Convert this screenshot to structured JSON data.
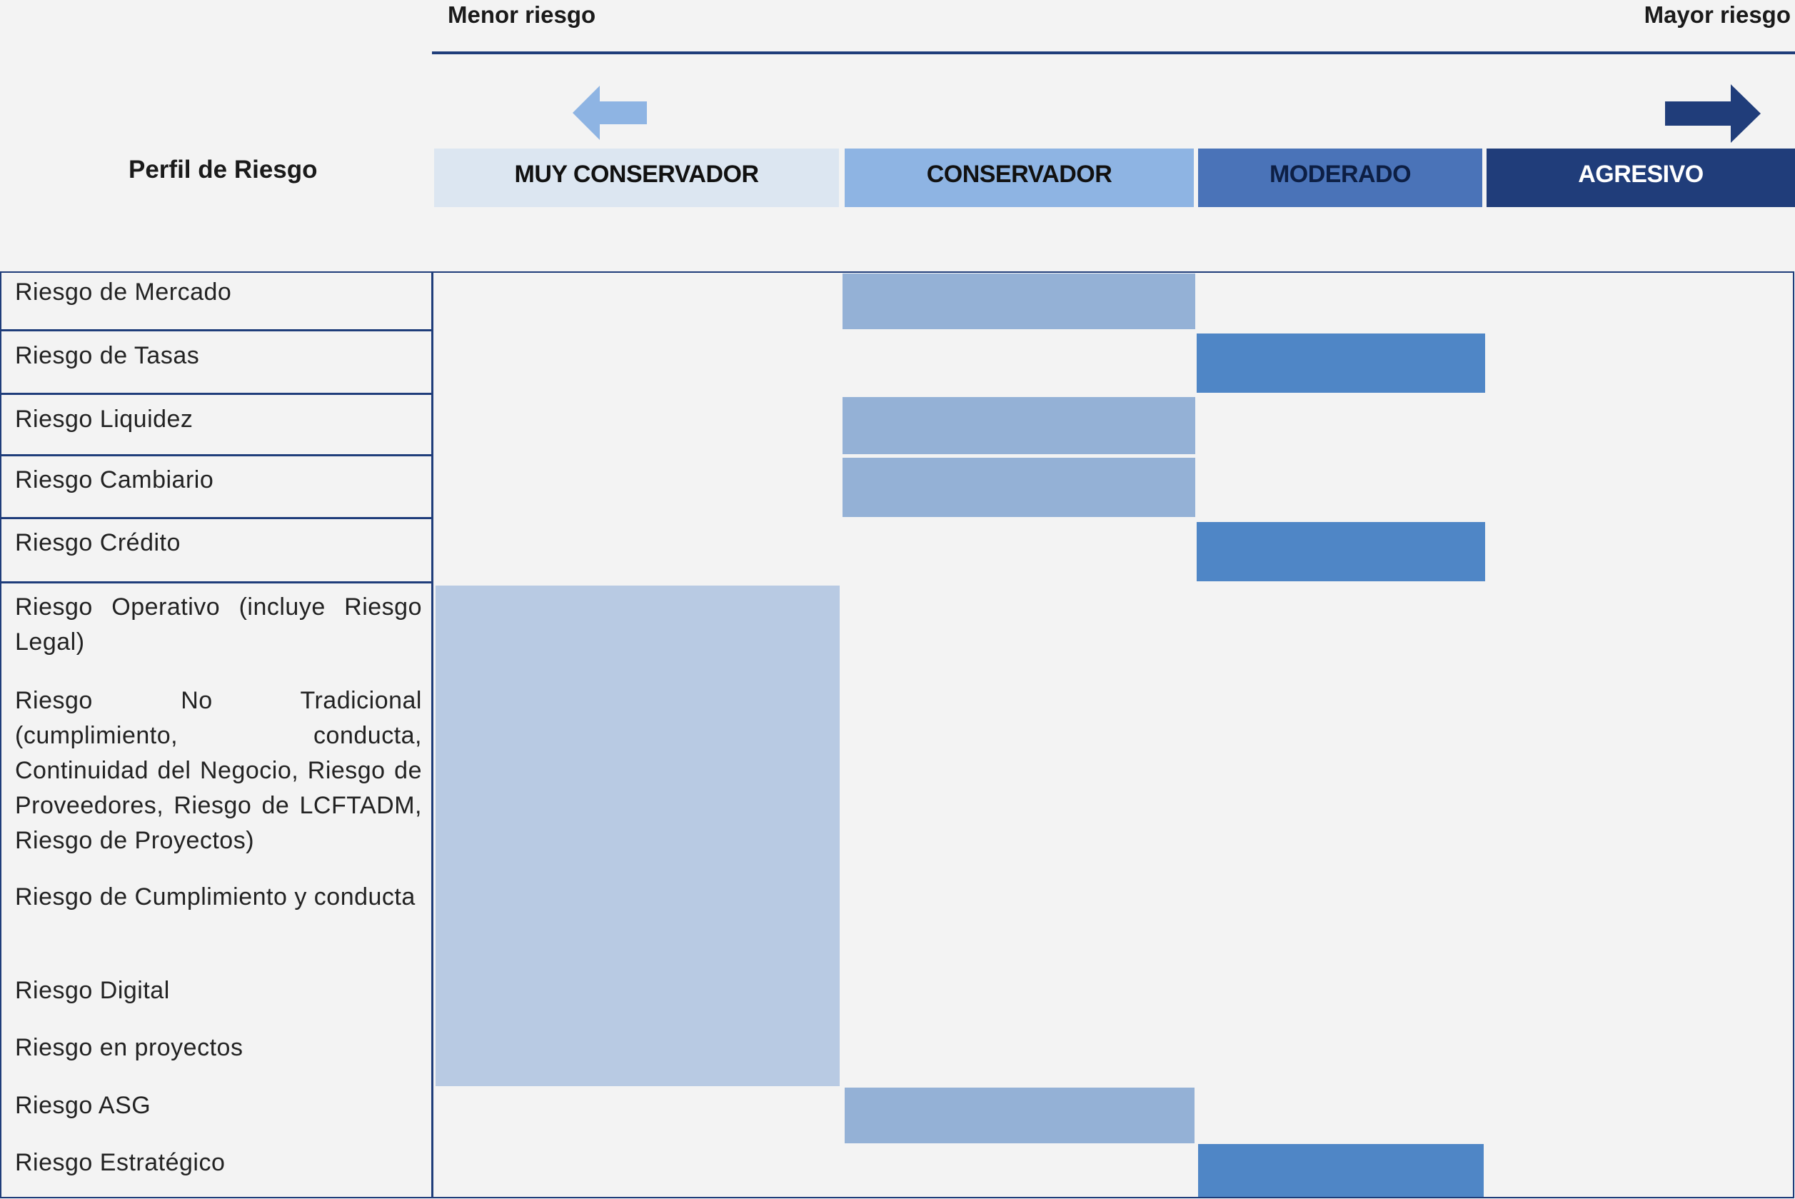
{
  "scale": {
    "left_label": "Menor riesgo",
    "right_label": "Mayor riesgo",
    "left_arrow_icon": "arrow-left-icon",
    "right_arrow_icon": "arrow-right-icon"
  },
  "profile": {
    "title": "Perfil de Riesgo",
    "levels": [
      {
        "label": "MUY CONSERVADOR",
        "bg": "#dce6f1",
        "fg": "#111111"
      },
      {
        "label": "CONSERVADOR",
        "bg": "#8eb4e3",
        "fg": "#111111"
      },
      {
        "label": "MODERADO",
        "bg": "#4a73b8",
        "fg": "#0d1f44"
      },
      {
        "label": "AGRESIVO",
        "bg": "#203d7a",
        "fg": "#ffffff"
      }
    ]
  },
  "risks": [
    {
      "label": "Riesgo de Mercado",
      "level": "CONSERVADOR"
    },
    {
      "label": "Riesgo de Tasas",
      "level": "MODERADO"
    },
    {
      "label": "Riesgo Liquidez",
      "level": "CONSERVADOR"
    },
    {
      "label": "Riesgo Cambiario",
      "level": "CONSERVADOR"
    },
    {
      "label": "Riesgo Crédito",
      "level": "MODERADO"
    },
    {
      "label": "Riesgo Operativo (incluye Riesgo Legal)",
      "level": "MUY CONSERVADOR"
    },
    {
      "label": "Riesgo No Tradicional (cumplimiento, conducta, Continuidad del Negocio, Riesgo de Proveedores, Riesgo de LCFTADM, Riesgo de Proyectos)",
      "level": "MUY CONSERVADOR"
    },
    {
      "label": "Riesgo de Cumplimiento y conducta",
      "level": "MUY CONSERVADOR"
    },
    {
      "label": "Riesgo Digital",
      "level": "MUY CONSERVADOR"
    },
    {
      "label": "Riesgo en proyectos",
      "level": "MUY CONSERVADOR"
    },
    {
      "label": "Riesgo ASG",
      "level": "CONSERVADOR"
    },
    {
      "label": "Riesgo Estratégico",
      "level": "MODERADO"
    }
  ],
  "colors": {
    "frame": "#1f3d7a",
    "bar_muy_conservador": "#b8cae3",
    "bar_conservador": "#94b1d6",
    "bar_moderado": "#4f86c6"
  }
}
